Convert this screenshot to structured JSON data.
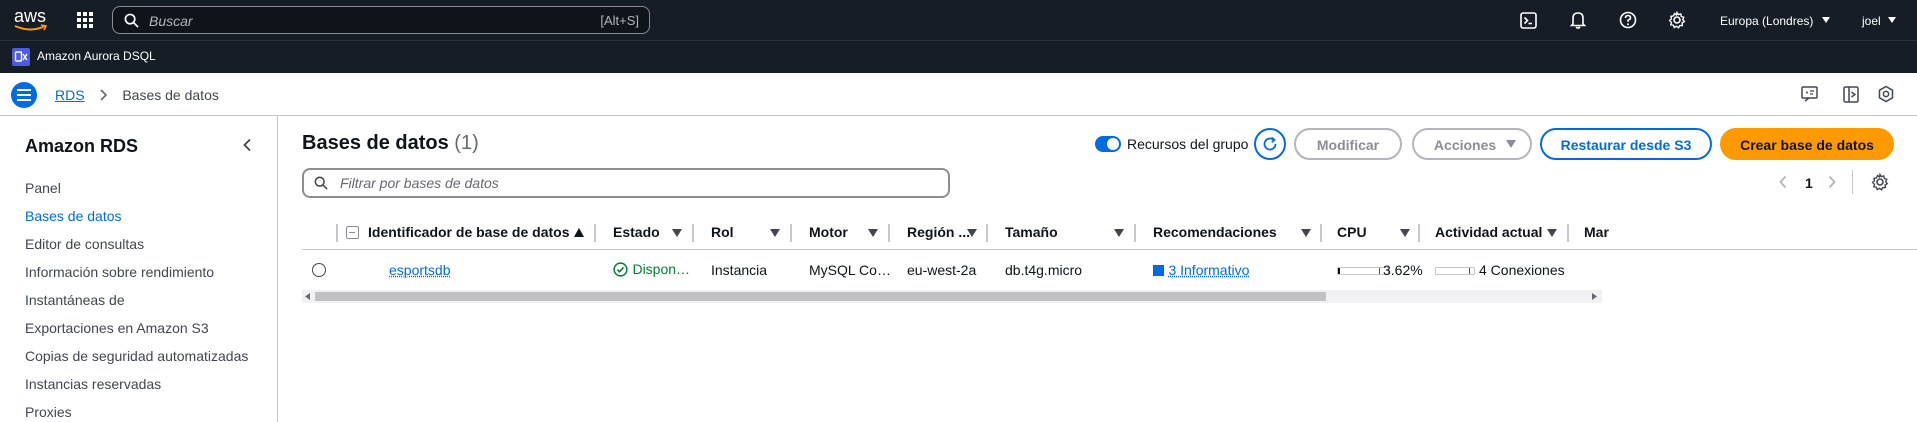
{
  "topnav": {
    "logo": "aws",
    "search_placeholder": "Buscar",
    "search_shortcut": "[Alt+S]",
    "region": "Europa (Londres)",
    "user": "joel"
  },
  "service_bar": {
    "service_name": "Amazon Aurora DSQL"
  },
  "breadcrumb": {
    "root": "RDS",
    "current": "Bases de datos"
  },
  "sidebar": {
    "title": "Amazon RDS",
    "items": [
      {
        "label": "Panel",
        "active": false
      },
      {
        "label": "Bases de datos",
        "active": true
      },
      {
        "label": "Editor de consultas",
        "active": false
      },
      {
        "label": "Información sobre rendimiento",
        "active": false
      },
      {
        "label": "Instantáneas de",
        "active": false
      },
      {
        "label": "Exportaciones en Amazon S3",
        "active": false
      },
      {
        "label": "Copias de seguridad automatizadas",
        "active": false
      },
      {
        "label": "Instancias reservadas",
        "active": false
      },
      {
        "label": "Proxies",
        "active": false
      }
    ]
  },
  "main": {
    "title": "Bases de datos",
    "count": "(1)",
    "toggle_label": "Recursos del grupo",
    "toggle_on": true,
    "buttons": {
      "modify": "Modificar",
      "actions": "Acciones",
      "restore": "Restaurar desde S3",
      "create": "Crear base de datos"
    },
    "filter_placeholder": "Filtrar por bases de datos",
    "page_number": "1"
  },
  "table": {
    "columns": [
      "Identificador de base de datos",
      "Estado",
      "Rol",
      "Motor",
      "Región ...",
      "Tamaño",
      "Recomendaciones",
      "CPU",
      "Actividad actual",
      "Mar"
    ],
    "rows": [
      {
        "identifier": "esportsdb",
        "status": "Dispon…",
        "role": "Instancia",
        "engine": "MySQL Co…",
        "region": "eu-west-2a",
        "size": "db.t4g.micro",
        "recommendations": "3 Informativo",
        "cpu": "3.62%",
        "cpu_fraction": 0.0362,
        "activity": "4 Conexiones"
      }
    ]
  },
  "colors": {
    "nav_bg": "#161d26",
    "link": "#006ce0",
    "primary_button": "#ff9900",
    "status_success": "#00802f"
  }
}
